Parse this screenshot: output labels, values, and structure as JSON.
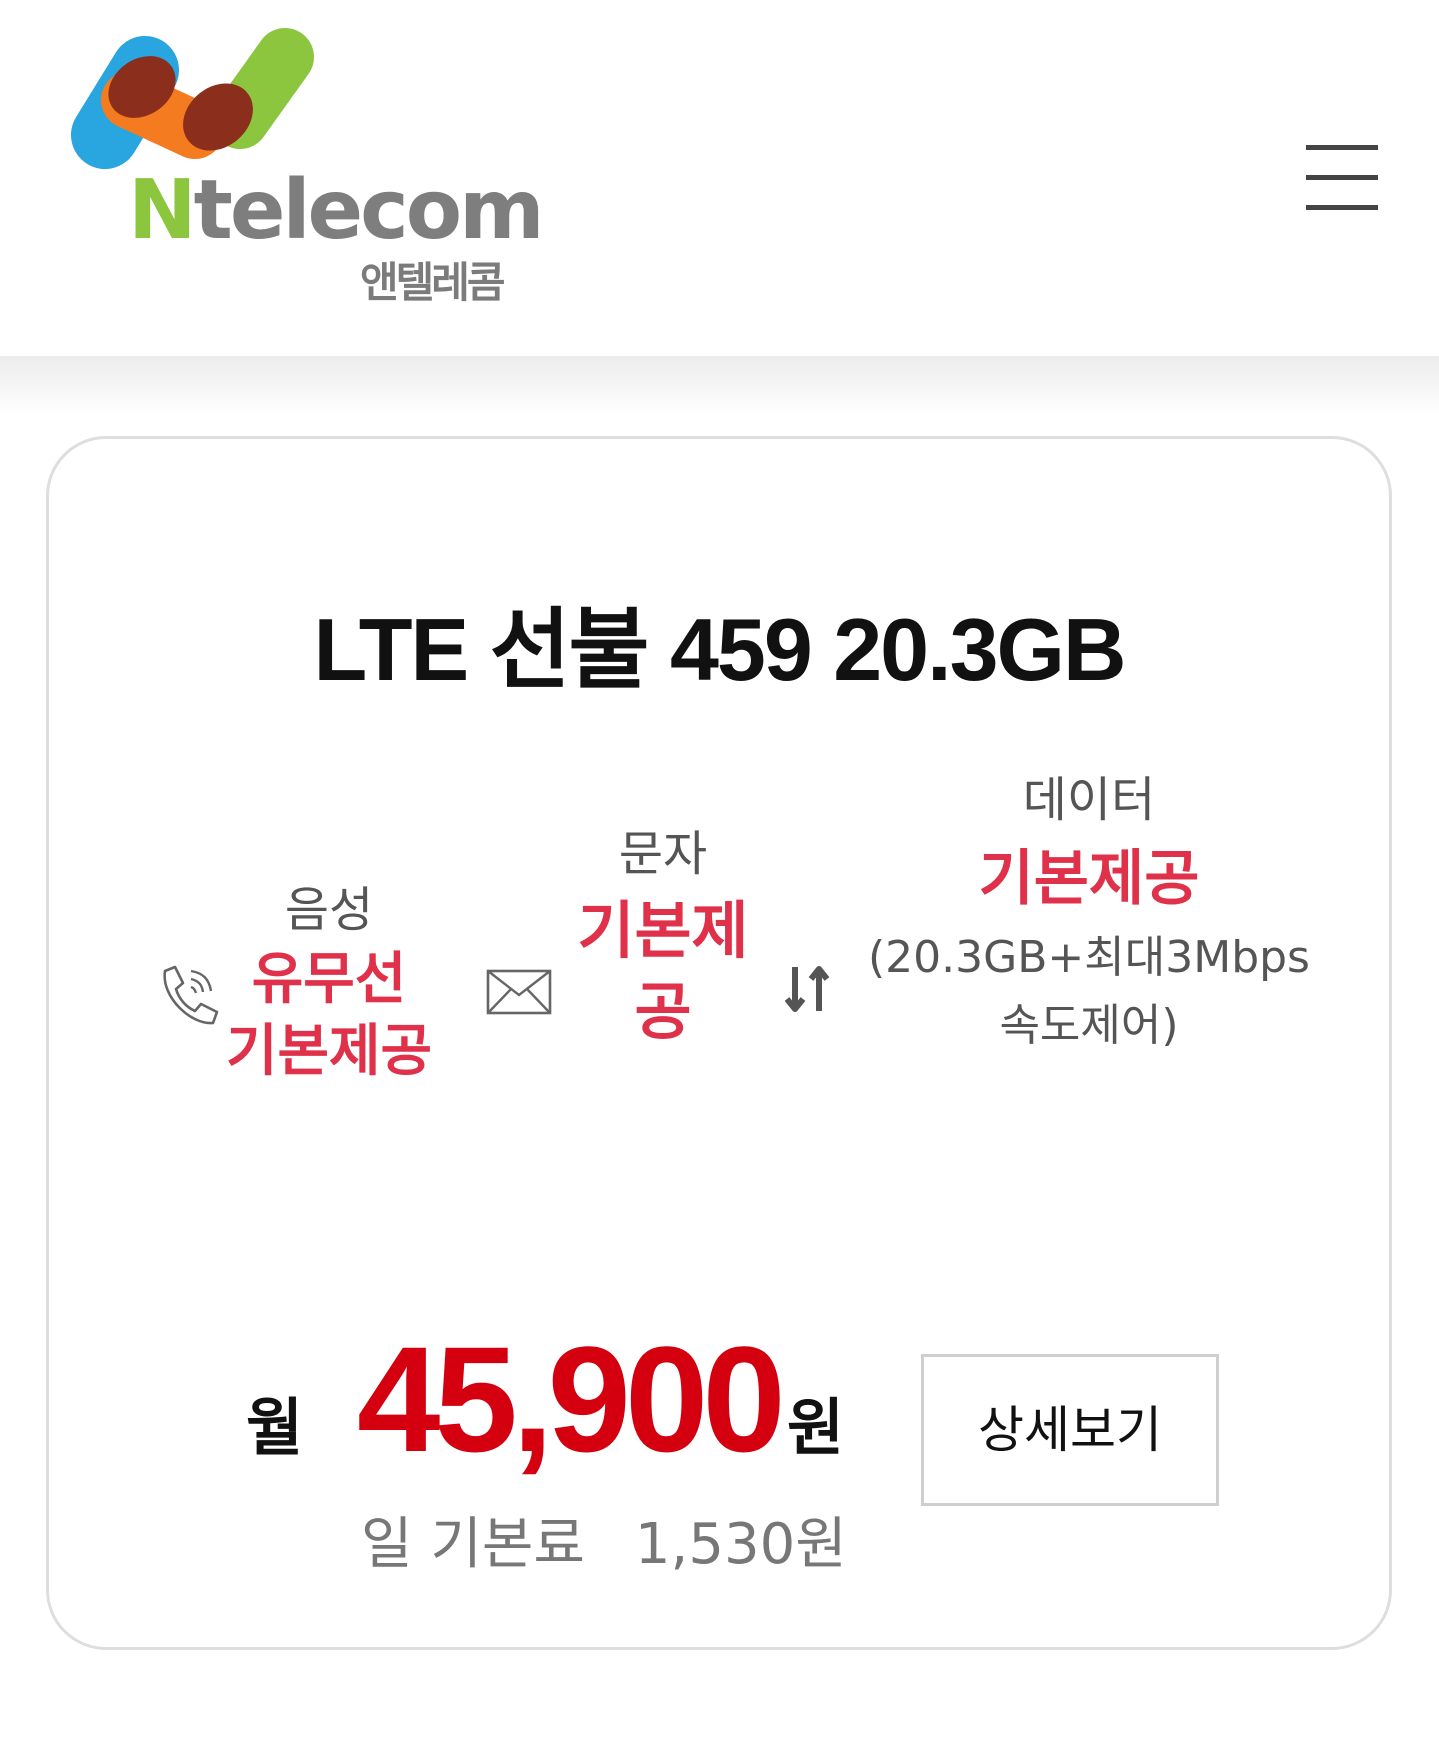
{
  "header": {
    "logo_text_prefix": "N",
    "logo_text_rest": "telecom",
    "logo_korean": "앤텔레콤",
    "menu_icon": "hamburger-menu-icon"
  },
  "plan": {
    "title": "LTE 선불 459 20.3GB",
    "voice": {
      "icon": "phone-icon",
      "label": "음성",
      "value_line1": "유무선",
      "value_line2": "기본제공"
    },
    "sms": {
      "icon": "envelope-icon",
      "label": "문자",
      "value_line1": "기본제",
      "value_line2": "공"
    },
    "data": {
      "icon": "data-transfer-arrows-icon",
      "label": "데이터",
      "value": "기본제공",
      "note_line1": "(20.3GB+최대3Mbps",
      "note_line2": "속도제어)"
    },
    "price": {
      "prefix": "월",
      "amount": "45,900",
      "suffix": "원",
      "daily_label": "일 기본료",
      "daily_amount": "1,530원"
    },
    "detail_button": "상세보기"
  },
  "colors": {
    "accent_red": "#d4000f",
    "feature_red": "#e0314b",
    "logo_green": "#8cc63f",
    "logo_blue": "#29a5e0",
    "logo_orange": "#f47b20",
    "logo_brown": "#8b2e1c"
  }
}
